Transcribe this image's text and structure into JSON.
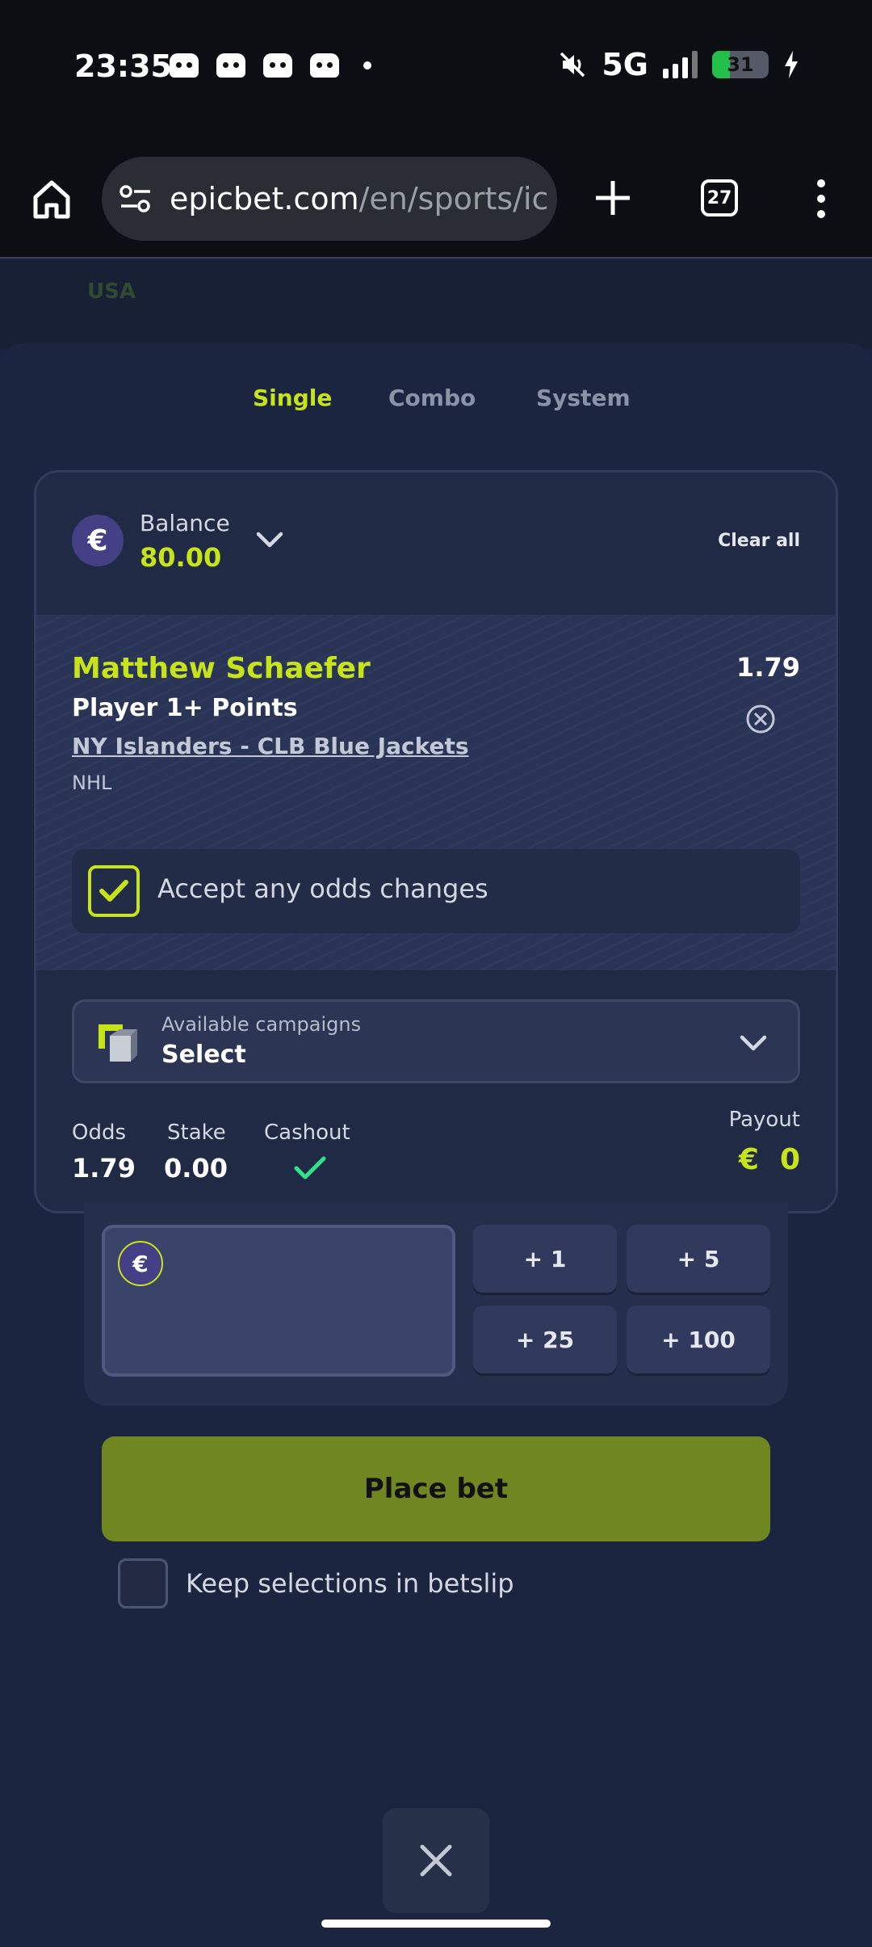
{
  "status_bar": {
    "time": "23:35",
    "network": "5G",
    "battery": "31",
    "battery_level": 0.31,
    "icons": [
      "discord-icon",
      "discord-icon",
      "discord-icon",
      "discord-icon",
      "dot-icon",
      "mute-icon",
      "signal-icon",
      "battery-icon",
      "charging-icon"
    ]
  },
  "browser": {
    "url_domain": "epicbet.com",
    "url_path": "/en/sports/ic",
    "tab_count": "27",
    "icons": [
      "home-icon",
      "site-settings-icon",
      "new-tab-icon",
      "tabs-icon",
      "menu-icon"
    ]
  },
  "page_behind": {
    "label": "USA"
  },
  "betslip": {
    "tabs": [
      {
        "label": "Single",
        "active": true
      },
      {
        "label": "Combo",
        "active": false
      },
      {
        "label": "System",
        "active": false
      }
    ],
    "balance": {
      "currency_symbol": "€",
      "label": "Balance",
      "value": "80.00"
    },
    "clear_all": "Clear all",
    "selection": {
      "player": "Matthew Schaefer",
      "market": "Player 1+ Points",
      "match": "NY Islanders - CLB Blue Jackets",
      "league": "NHL",
      "odds": "1.79"
    },
    "accept_odds": {
      "label": "Accept any odds changes",
      "checked": true
    },
    "campaigns": {
      "label": "Available campaigns",
      "value": "Select"
    },
    "summary": {
      "odds_label": "Odds",
      "odds_value": "1.79",
      "stake_label": "Stake",
      "stake_value": "0.00",
      "cashout_label": "Cashout",
      "cashout_available": true,
      "payout_label": "Payout",
      "payout_currency": "€",
      "payout_value": "0"
    },
    "stake_input": {
      "currency_symbol": "€",
      "value": ""
    },
    "quick_stakes": [
      "+ 1",
      "+ 5",
      "+ 25",
      "+ 100"
    ],
    "place_bet": "Place bet",
    "keep_selections": {
      "label": "Keep selections in betslip",
      "checked": false
    }
  },
  "colors": {
    "accent": "#c7e41a",
    "background": "#1c2540",
    "place_bet_bg": "#6f8621",
    "cashout_check": "#2ee38a"
  }
}
